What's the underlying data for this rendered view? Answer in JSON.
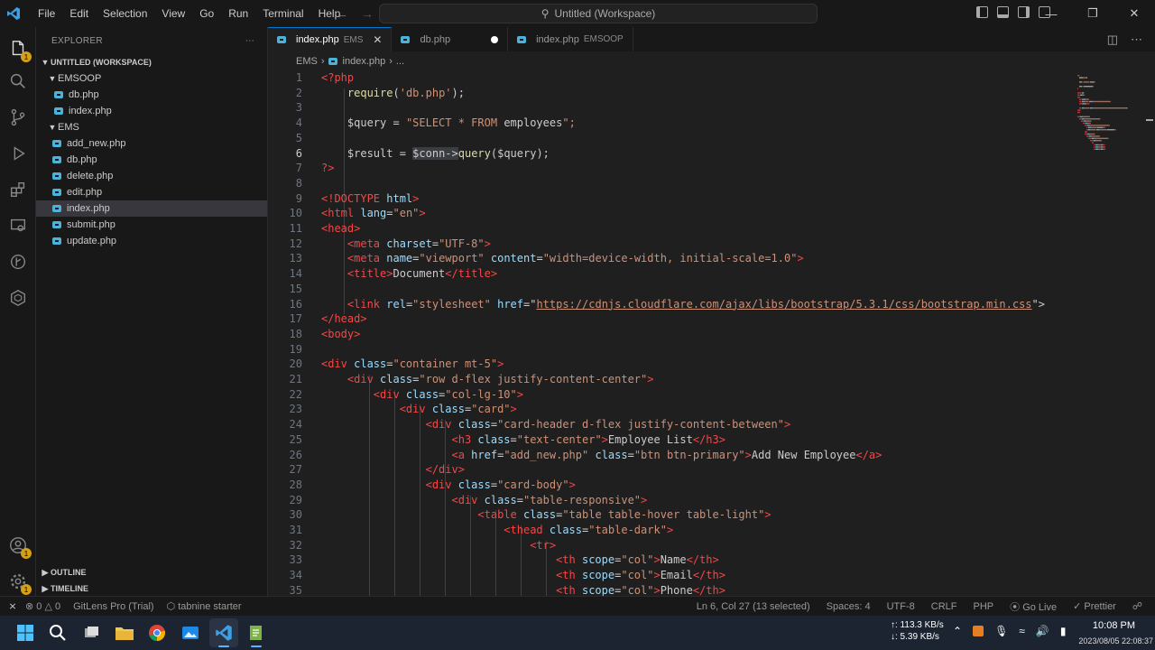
{
  "titlebar": {
    "menu": [
      "File",
      "Edit",
      "Selection",
      "View",
      "Go",
      "Run",
      "Terminal",
      "Help"
    ],
    "title": "Untitled (Workspace)"
  },
  "sidebar": {
    "header": "EXPLORER",
    "workspace": "UNTITLED (WORKSPACE)",
    "folders": [
      {
        "name": "EMSOOP",
        "files": [
          "db.php",
          "index.php"
        ]
      },
      {
        "name": "EMS",
        "files": [
          "add_new.php",
          "db.php",
          "delete.php",
          "edit.php",
          "index.php",
          "submit.php",
          "update.php"
        ]
      }
    ],
    "selected": "index.php",
    "outline": "OUTLINE",
    "timeline": "TIMELINE"
  },
  "tabs": [
    {
      "label": "index.php",
      "desc": "EMS",
      "active": true
    },
    {
      "label": "db.php",
      "desc": "",
      "dirty": true
    },
    {
      "label": "index.php",
      "desc": "EMSOOP"
    }
  ],
  "breadcrumb": [
    "EMS",
    "index.php",
    "..."
  ],
  "code_lines": [
    [
      [
        "<?php",
        "#f44747"
      ]
    ],
    [
      [
        "    require",
        "#dcdcaa"
      ],
      [
        "(",
        "#ccc"
      ],
      [
        "'db.php'",
        "#ce9178"
      ],
      [
        ");",
        "#ccc"
      ]
    ],
    [],
    [
      [
        "    $query",
        "#ccc"
      ],
      [
        " = ",
        "#ccc"
      ],
      [
        "\"SELECT * FROM ",
        "#ce9178"
      ],
      [
        "employees",
        "#ccc"
      ],
      [
        "\";",
        "#ce9178"
      ]
    ],
    [],
    [
      [
        "    $result",
        "#ccc"
      ],
      [
        " = ",
        "#ccc"
      ],
      [
        "$conn->",
        "#ccc"
      ],
      [
        "query",
        "#dcdcaa"
      ],
      [
        "($query);",
        "#ccc"
      ]
    ],
    [
      [
        "?>",
        "#f44747"
      ]
    ],
    [],
    [
      [
        "<!DOCTYPE ",
        "#f44747"
      ],
      [
        "html",
        "#9cdcfe"
      ],
      [
        ">",
        "#f44747"
      ]
    ],
    [
      [
        "<html ",
        "#f44747"
      ],
      [
        "lang",
        "#9cdcfe"
      ],
      [
        "=",
        "#ccc"
      ],
      [
        "\"en\"",
        "#ce9178"
      ],
      [
        ">",
        "#f44747"
      ]
    ],
    [
      [
        "<head>",
        "#f44747"
      ]
    ],
    [
      [
        "    <meta ",
        "#f44747"
      ],
      [
        "charset",
        "#9cdcfe"
      ],
      [
        "=",
        "#ccc"
      ],
      [
        "\"UTF-8\"",
        "#ce9178"
      ],
      [
        ">",
        "#f44747"
      ]
    ],
    [
      [
        "    <meta ",
        "#f44747"
      ],
      [
        "name",
        "#9cdcfe"
      ],
      [
        "=",
        "#ccc"
      ],
      [
        "\"viewport\" ",
        "#ce9178"
      ],
      [
        "content",
        "#9cdcfe"
      ],
      [
        "=",
        "#ccc"
      ],
      [
        "\"width=device-width, initial-scale=1.0\"",
        "#ce9178"
      ],
      [
        ">",
        "#f44747"
      ]
    ],
    [
      [
        "    <title>",
        "#f44747"
      ],
      [
        "Document",
        "#ccc"
      ],
      [
        "</title>",
        "#f44747"
      ]
    ],
    [],
    [
      [
        "    <link ",
        "#f44747"
      ],
      [
        "rel",
        "#9cdcfe"
      ],
      [
        "=",
        "#ccc"
      ],
      [
        "\"stylesheet\" ",
        "#ce9178"
      ],
      [
        "href",
        "#9cdcfe"
      ],
      [
        "=\"",
        "#ccc"
      ],
      [
        "https://cdnjs.cloudflare.com/ajax/libs/bootstrap/5.3.1/css/bootstrap.min.css",
        "#ce9178"
      ],
      [
        "\">",
        "#ccc"
      ]
    ],
    [
      [
        "</head>",
        "#f44747"
      ]
    ],
    [
      [
        "<body>",
        "#f44747"
      ]
    ],
    [],
    [
      [
        "<div ",
        "#f44747"
      ],
      [
        "class",
        "#9cdcfe"
      ],
      [
        "=",
        "#ccc"
      ],
      [
        "\"container mt-5\"",
        "#ce9178"
      ],
      [
        ">",
        "#f44747"
      ]
    ],
    [
      [
        "    <div ",
        "#f44747"
      ],
      [
        "class",
        "#9cdcfe"
      ],
      [
        "=",
        "#ccc"
      ],
      [
        "\"row d-flex justify-content-center\"",
        "#ce9178"
      ],
      [
        ">",
        "#f44747"
      ]
    ],
    [
      [
        "        <div ",
        "#f44747"
      ],
      [
        "class",
        "#9cdcfe"
      ],
      [
        "=",
        "#ccc"
      ],
      [
        "\"col-lg-10\"",
        "#ce9178"
      ],
      [
        ">",
        "#f44747"
      ]
    ],
    [
      [
        "            <div ",
        "#f44747"
      ],
      [
        "class",
        "#9cdcfe"
      ],
      [
        "=",
        "#ccc"
      ],
      [
        "\"card\"",
        "#ce9178"
      ],
      [
        ">",
        "#f44747"
      ]
    ],
    [
      [
        "                <div ",
        "#f44747"
      ],
      [
        "class",
        "#9cdcfe"
      ],
      [
        "=",
        "#ccc"
      ],
      [
        "\"card-header d-flex justify-content-between\"",
        "#ce9178"
      ],
      [
        ">",
        "#f44747"
      ]
    ],
    [
      [
        "                    <h3 ",
        "#f44747"
      ],
      [
        "class",
        "#9cdcfe"
      ],
      [
        "=",
        "#ccc"
      ],
      [
        "\"text-center\"",
        "#ce9178"
      ],
      [
        ">",
        "#f44747"
      ],
      [
        "Employee List",
        "#ccc"
      ],
      [
        "</h3>",
        "#f44747"
      ]
    ],
    [
      [
        "                    <a ",
        "#f44747"
      ],
      [
        "href",
        "#9cdcfe"
      ],
      [
        "=",
        "#ccc"
      ],
      [
        "\"add_new.php\" ",
        "#ce9178"
      ],
      [
        "class",
        "#9cdcfe"
      ],
      [
        "=",
        "#ccc"
      ],
      [
        "\"btn btn-primary\"",
        "#ce9178"
      ],
      [
        ">",
        "#f44747"
      ],
      [
        "Add New Employee",
        "#ccc"
      ],
      [
        "</a>",
        "#f44747"
      ]
    ],
    [
      [
        "                </div>",
        "#f44747"
      ]
    ],
    [
      [
        "                <div ",
        "#f44747"
      ],
      [
        "class",
        "#9cdcfe"
      ],
      [
        "=",
        "#ccc"
      ],
      [
        "\"card-body\"",
        "#ce9178"
      ],
      [
        ">",
        "#f44747"
      ]
    ],
    [
      [
        "                    <div ",
        "#f44747"
      ],
      [
        "class",
        "#9cdcfe"
      ],
      [
        "=",
        "#ccc"
      ],
      [
        "\"table-responsive\"",
        "#ce9178"
      ],
      [
        ">",
        "#f44747"
      ]
    ],
    [
      [
        "                        <table ",
        "#f44747"
      ],
      [
        "class",
        "#9cdcfe"
      ],
      [
        "=",
        "#ccc"
      ],
      [
        "\"table table-hover table-light\"",
        "#ce9178"
      ],
      [
        ">",
        "#f44747"
      ]
    ],
    [
      [
        "                            <thead ",
        "#f44747"
      ],
      [
        "class",
        "#9cdcfe"
      ],
      [
        "=",
        "#ccc"
      ],
      [
        "\"table-dark\"",
        "#ce9178"
      ],
      [
        ">",
        "#f44747"
      ]
    ],
    [
      [
        "                                <tr>",
        "#f44747"
      ]
    ],
    [
      [
        "                                    <th ",
        "#f44747"
      ],
      [
        "scope",
        "#9cdcfe"
      ],
      [
        "=",
        "#ccc"
      ],
      [
        "\"col\"",
        "#ce9178"
      ],
      [
        ">",
        "#f44747"
      ],
      [
        "Name",
        "#ccc"
      ],
      [
        "</th>",
        "#f44747"
      ]
    ],
    [
      [
        "                                    <th ",
        "#f44747"
      ],
      [
        "scope",
        "#9cdcfe"
      ],
      [
        "=",
        "#ccc"
      ],
      [
        "\"col\"",
        "#ce9178"
      ],
      [
        ">",
        "#f44747"
      ],
      [
        "Email",
        "#ccc"
      ],
      [
        "</th>",
        "#f44747"
      ]
    ],
    [
      [
        "                                    <th ",
        "#f44747"
      ],
      [
        "scope",
        "#9cdcfe"
      ],
      [
        "=",
        "#ccc"
      ],
      [
        "\"col\"",
        "#ce9178"
      ],
      [
        ">",
        "#f44747"
      ],
      [
        "Phone",
        "#ccc"
      ],
      [
        "</th>",
        "#f44747"
      ]
    ]
  ],
  "current_line": 6,
  "statusbar": {
    "errors": "0",
    "warnings": "0",
    "gitlens": "GitLens Pro (Trial)",
    "tabnine": "tabnine starter",
    "position": "Ln 6, Col 27 (13 selected)",
    "spaces": "Spaces: 4",
    "encoding": "UTF-8",
    "eol": "CRLF",
    "language": "PHP",
    "golive": "Go Live",
    "prettier": "Prettier"
  },
  "taskbar": {
    "net_up": "↑: 113.3 KB/s",
    "net_down": "↓: 5.39 KB/s",
    "time": "10:08 PM",
    "stamp": "2023/08/05 22:08:37"
  }
}
